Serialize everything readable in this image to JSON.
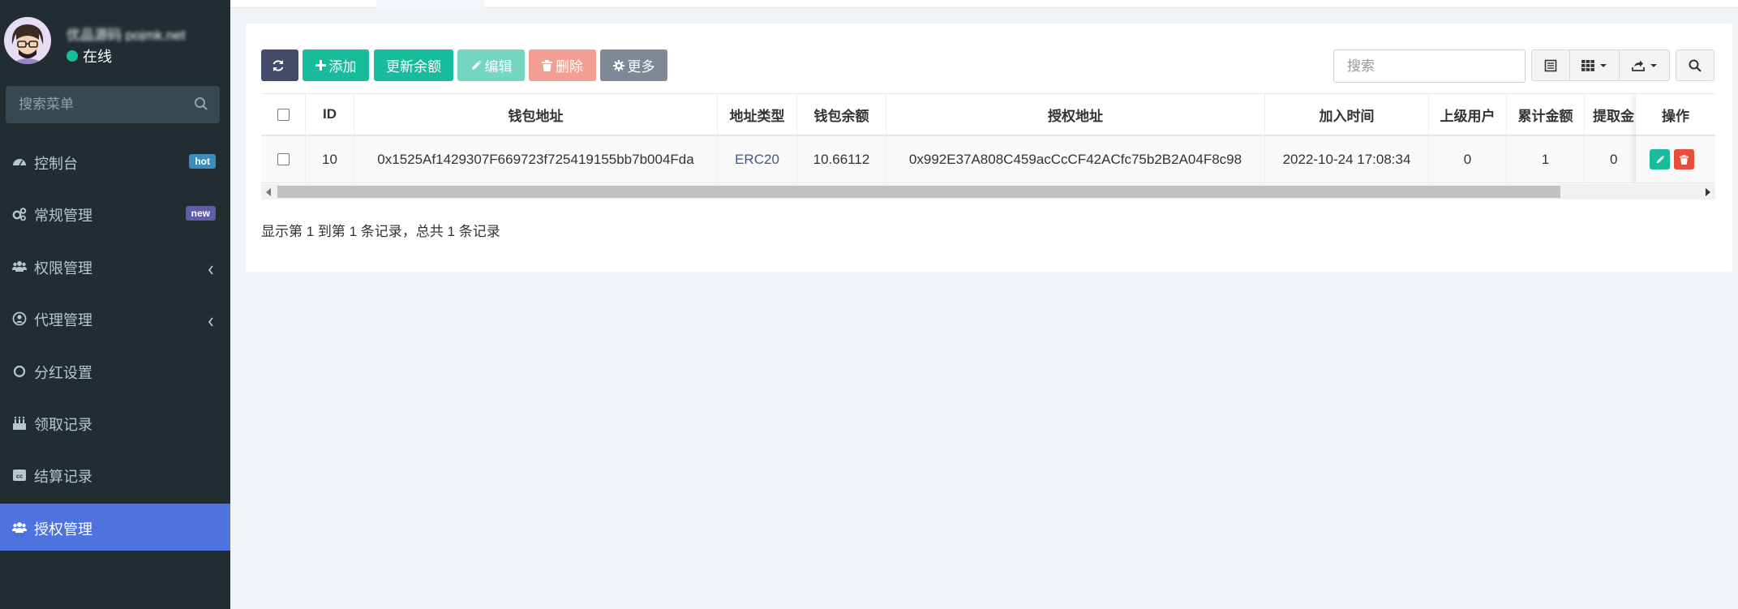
{
  "user": {
    "name": "优品源码 pojmk.net",
    "status": "在线"
  },
  "menu_search": {
    "placeholder": "搜索菜单"
  },
  "nav": [
    {
      "label": "控制台",
      "icon": "dashboard-icon",
      "badge": "hot"
    },
    {
      "label": "常规管理",
      "icon": "cogs-icon",
      "badge": "new"
    },
    {
      "label": "权限管理",
      "icon": "users-icon",
      "badge": ""
    },
    {
      "label": "代理管理",
      "icon": "user-circle-icon",
      "badge": ""
    },
    {
      "label": "分红设置",
      "icon": "circle-icon",
      "badge": ""
    },
    {
      "label": "领取记录",
      "icon": "birthday-cake-icon",
      "badge": ""
    },
    {
      "label": "结算记录",
      "icon": "cc-icon",
      "badge": ""
    },
    {
      "label": "授权管理",
      "icon": "users-icon",
      "badge": "",
      "active": true
    }
  ],
  "toolbar": {
    "add": "添加",
    "update_balance": "更新余额",
    "edit": "编辑",
    "delete": "删除",
    "more": "更多",
    "search_placeholder": "搜索"
  },
  "table": {
    "columns": [
      "ID",
      "钱包地址",
      "地址类型",
      "钱包余额",
      "授权地址",
      "加入时间",
      "上级用户",
      "累计金额",
      "提取金",
      "操作"
    ],
    "rows": [
      {
        "id": "10",
        "wallet_address": "0x1525Af1429307F669723f725419155bb7b004Fda",
        "address_type": "ERC20",
        "balance": "10.66112",
        "auth_address": "0x992E37A808C459acCcCF42ACfc75b2B2A04F8c98",
        "join_time": "2022-10-24 17:08:34",
        "parent_user": "0",
        "total_amount": "1",
        "withdraw": "0"
      }
    ]
  },
  "pager": {
    "info": "显示第 1 到第 1 条记录，总共 1 条记录"
  },
  "colors": {
    "sidebar": "#222d32",
    "active": "#4e73df",
    "primary": "#18bc9c",
    "danger": "#e74c3c",
    "dark": "#444c69"
  }
}
